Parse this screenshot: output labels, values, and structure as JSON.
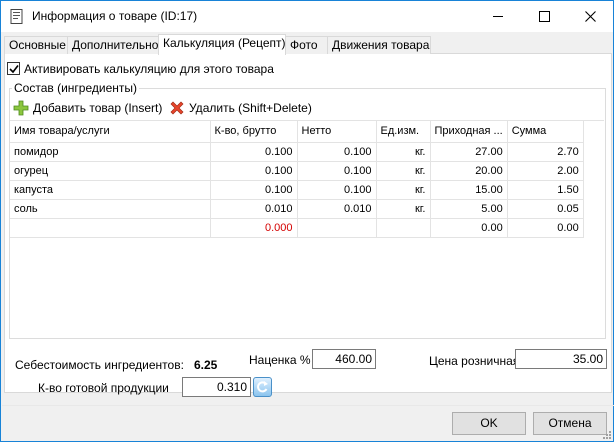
{
  "window": {
    "title": "Информация о товаре (ID:17)"
  },
  "tabs": [
    {
      "label": "Основные"
    },
    {
      "label": "Дополнительно"
    },
    {
      "label": "Калькуляция (Рецепт)"
    },
    {
      "label": "Фото"
    },
    {
      "label": "Движения товара"
    }
  ],
  "calc": {
    "activate_label": "Активировать калькуляцию для этого товара",
    "activate_checked": true,
    "group_title": "Состав (ингредиенты)",
    "add_label": "Добавить товар (Insert)",
    "delete_label": "Удалить (Shift+Delete)"
  },
  "grid": {
    "headers": [
      "Имя товара/услуги",
      "К-во, брутто",
      "Нетто",
      "Ед.изм.",
      "Приходная ...",
      "Сумма"
    ],
    "rows": [
      [
        "помидор",
        "0.100",
        "0.100",
        "кг.",
        "27.00",
        "2.70"
      ],
      [
        "огурец",
        "0.100",
        "0.100",
        "кг.",
        "20.00",
        "2.00"
      ],
      [
        "капуста",
        "0.100",
        "0.100",
        "кг.",
        "15.00",
        "1.50"
      ],
      [
        "соль",
        "0.010",
        "0.010",
        "кг.",
        "5.00",
        "0.05"
      ],
      [
        "",
        "0.000",
        "",
        "",
        "0.00",
        "0.00"
      ]
    ]
  },
  "footer": {
    "cost_label": "Себестоимость ингредиентов:",
    "cost_value": "6.25",
    "markup_label": "Наценка %",
    "markup_value": "460.00",
    "retail_label": "Цена розничная",
    "retail_value": "35.00",
    "output_label": "К-во готовой продукции",
    "output_value": "0.310"
  },
  "buttons": {
    "ok": "OK",
    "cancel": "Отмена"
  }
}
